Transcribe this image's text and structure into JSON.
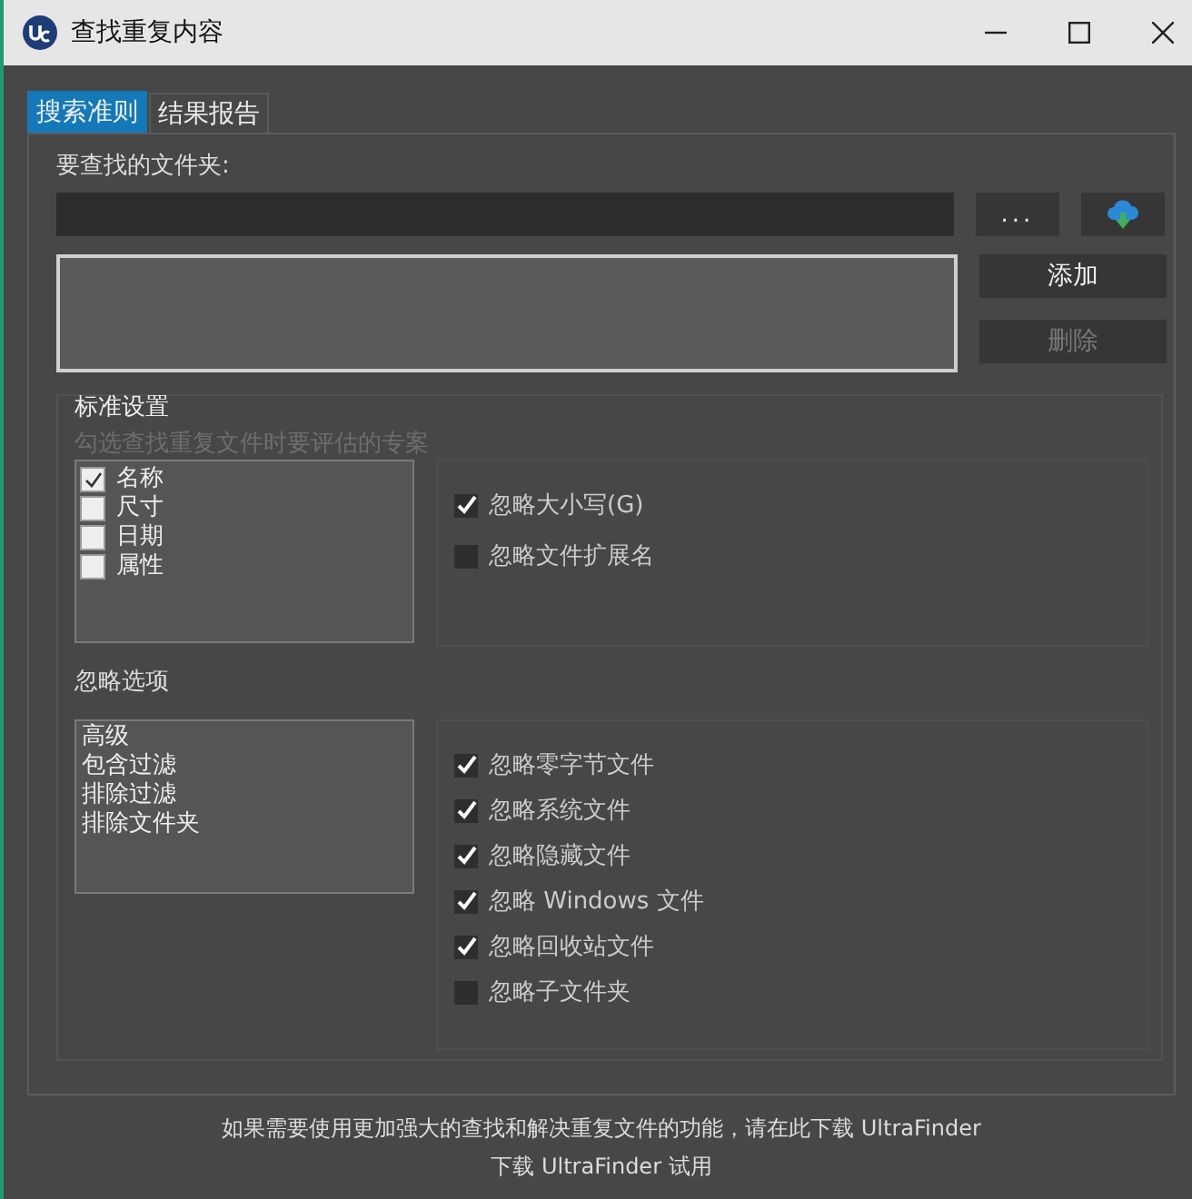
{
  "window": {
    "title": "查找重复内容"
  },
  "tabs": [
    {
      "label": "搜索准则",
      "selected": true
    },
    {
      "label": "结果报告",
      "selected": false
    }
  ],
  "folder": {
    "label": "要查找的文件夹:",
    "browse_button": "...",
    "add_button": {
      "label": "添加",
      "disabled": false
    },
    "delete_button": {
      "label": "删除",
      "disabled": true
    }
  },
  "standard_settings": {
    "title": "标准设置",
    "hint": "勾选查找重复文件时要评估的专案",
    "criteria": [
      {
        "label": "名称",
        "checked": true
      },
      {
        "label": "尺寸",
        "checked": false
      },
      {
        "label": "日期",
        "checked": false
      },
      {
        "label": "属性",
        "checked": false
      }
    ],
    "options": [
      {
        "label": "忽略大小写(G)",
        "checked": true
      },
      {
        "label": "忽略文件扩展名",
        "checked": false
      }
    ]
  },
  "ignore_options": {
    "title": "忽略选项",
    "items": [
      "高级",
      "包含过滤",
      "排除过滤",
      "排除文件夹"
    ],
    "options": [
      {
        "label": "忽略零字节文件",
        "checked": true
      },
      {
        "label": "忽略系统文件",
        "checked": true
      },
      {
        "label": "忽略隐藏文件",
        "checked": true
      },
      {
        "label": "忽略 Windows 文件",
        "checked": true
      },
      {
        "label": "忽略回收站文件",
        "checked": true
      },
      {
        "label": "忽略子文件夹",
        "checked": false
      }
    ]
  },
  "footer": [
    "如果需要使用更加强大的查找和解决重复文件的功能，请在此下载 UltraFinder",
    "下载 UltraFinder 试用"
  ]
}
